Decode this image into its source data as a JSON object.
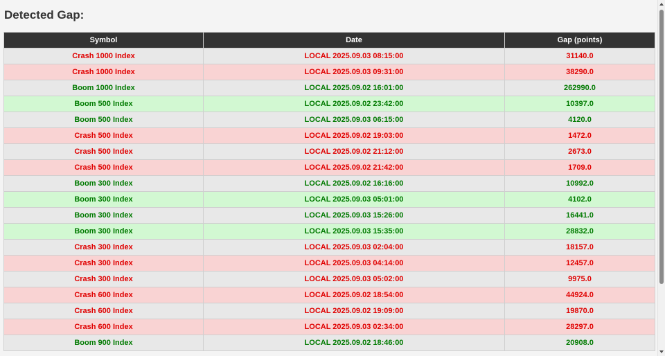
{
  "heading": "Detected Gap:",
  "table": {
    "columns": [
      "Symbol",
      "Date",
      "Gap (points)"
    ],
    "rows": [
      {
        "symbol": "Crash 1000 Index",
        "date": "LOCAL 2025.09.03 08:15:00",
        "gap": "31140.0",
        "kind": "crash"
      },
      {
        "symbol": "Crash 1000 Index",
        "date": "LOCAL 2025.09.03 09:31:00",
        "gap": "38290.0",
        "kind": "crash"
      },
      {
        "symbol": "Boom 1000 Index",
        "date": "LOCAL 2025.09.02 16:01:00",
        "gap": "262990.0",
        "kind": "boom"
      },
      {
        "symbol": "Boom 500 Index",
        "date": "LOCAL 2025.09.02 23:42:00",
        "gap": "10397.0",
        "kind": "boom"
      },
      {
        "symbol": "Boom 500 Index",
        "date": "LOCAL 2025.09.03 06:15:00",
        "gap": "4120.0",
        "kind": "boom"
      },
      {
        "symbol": "Crash 500 Index",
        "date": "LOCAL 2025.09.02 19:03:00",
        "gap": "1472.0",
        "kind": "crash"
      },
      {
        "symbol": "Crash 500 Index",
        "date": "LOCAL 2025.09.02 21:12:00",
        "gap": "2673.0",
        "kind": "crash"
      },
      {
        "symbol": "Crash 500 Index",
        "date": "LOCAL 2025.09.02 21:42:00",
        "gap": "1709.0",
        "kind": "crash"
      },
      {
        "symbol": "Boom 300 Index",
        "date": "LOCAL 2025.09.02 16:16:00",
        "gap": "10992.0",
        "kind": "boom"
      },
      {
        "symbol": "Boom 300 Index",
        "date": "LOCAL 2025.09.03 05:01:00",
        "gap": "4102.0",
        "kind": "boom"
      },
      {
        "symbol": "Boom 300 Index",
        "date": "LOCAL 2025.09.03 15:26:00",
        "gap": "16441.0",
        "kind": "boom"
      },
      {
        "symbol": "Boom 300 Index",
        "date": "LOCAL 2025.09.03 15:35:00",
        "gap": "28832.0",
        "kind": "boom"
      },
      {
        "symbol": "Crash 300 Index",
        "date": "LOCAL 2025.09.03 02:04:00",
        "gap": "18157.0",
        "kind": "crash"
      },
      {
        "symbol": "Crash 300 Index",
        "date": "LOCAL 2025.09.03 04:14:00",
        "gap": "12457.0",
        "kind": "crash"
      },
      {
        "symbol": "Crash 300 Index",
        "date": "LOCAL 2025.09.03 05:02:00",
        "gap": "9975.0",
        "kind": "crash"
      },
      {
        "symbol": "Crash 600 Index",
        "date": "LOCAL 2025.09.02 18:54:00",
        "gap": "44924.0",
        "kind": "crash"
      },
      {
        "symbol": "Crash 600 Index",
        "date": "LOCAL 2025.09.02 19:09:00",
        "gap": "19870.0",
        "kind": "crash"
      },
      {
        "symbol": "Crash 600 Index",
        "date": "LOCAL 2025.09.03 02:34:00",
        "gap": "28297.0",
        "kind": "crash"
      },
      {
        "symbol": "Boom 900 Index",
        "date": "LOCAL 2025.09.02 18:46:00",
        "gap": "20908.0",
        "kind": "boom"
      }
    ]
  },
  "colors": {
    "crash_text": "#e00000",
    "boom_text": "#007a00",
    "neutral_row": "#e8e8e8",
    "crash_row": "#f9d3d3",
    "boom_row": "#d2f8d2",
    "header_bg": "#333333"
  }
}
